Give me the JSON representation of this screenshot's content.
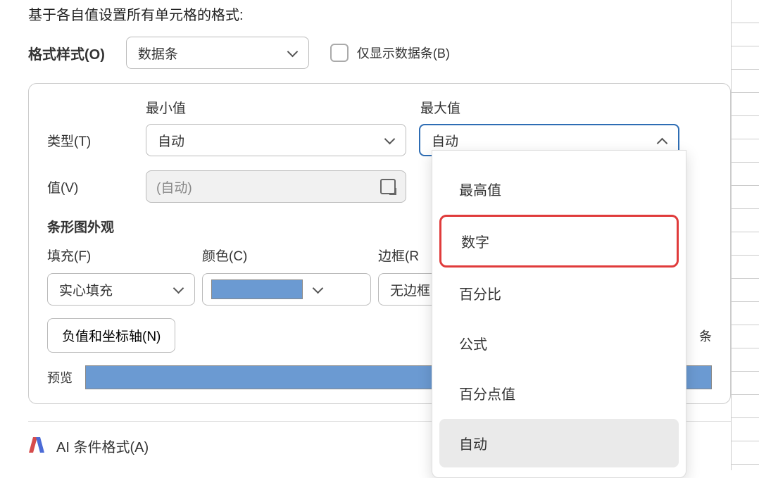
{
  "intro": "基于各自值设置所有单元格的格式:",
  "formatStyle": {
    "label": "格式样式(O)",
    "selected": "数据条"
  },
  "showOnlyBar": {
    "label": "仅显示数据条(B)"
  },
  "panel": {
    "minHeader": "最小值",
    "maxHeader": "最大值",
    "typeLabel": "类型(T)",
    "typeMin": "自动",
    "typeMax": "自动",
    "valueLabel": "值(V)",
    "valueMinPlaceholder": "(自动)",
    "appearanceTitle": "条形图外观",
    "fillLabel": "填充(F)",
    "fillSelected": "实心填充",
    "colorLabel": "颜色(C)",
    "borderLabel": "边框(R",
    "borderSelected": "无边框",
    "negButton": "负值和坐标轴(N)",
    "barDirPartial": "条",
    "previewLabel": "预览"
  },
  "ai": {
    "label": "AI 条件格式(A)"
  },
  "dropdown": {
    "items": [
      {
        "label": "最高值",
        "highlighted": false,
        "selected": false
      },
      {
        "label": "数字",
        "highlighted": true,
        "selected": false
      },
      {
        "label": "百分比",
        "highlighted": false,
        "selected": false
      },
      {
        "label": "公式",
        "highlighted": false,
        "selected": false
      },
      {
        "label": "百分点值",
        "highlighted": false,
        "selected": false
      },
      {
        "label": "自动",
        "highlighted": false,
        "selected": true
      }
    ]
  }
}
